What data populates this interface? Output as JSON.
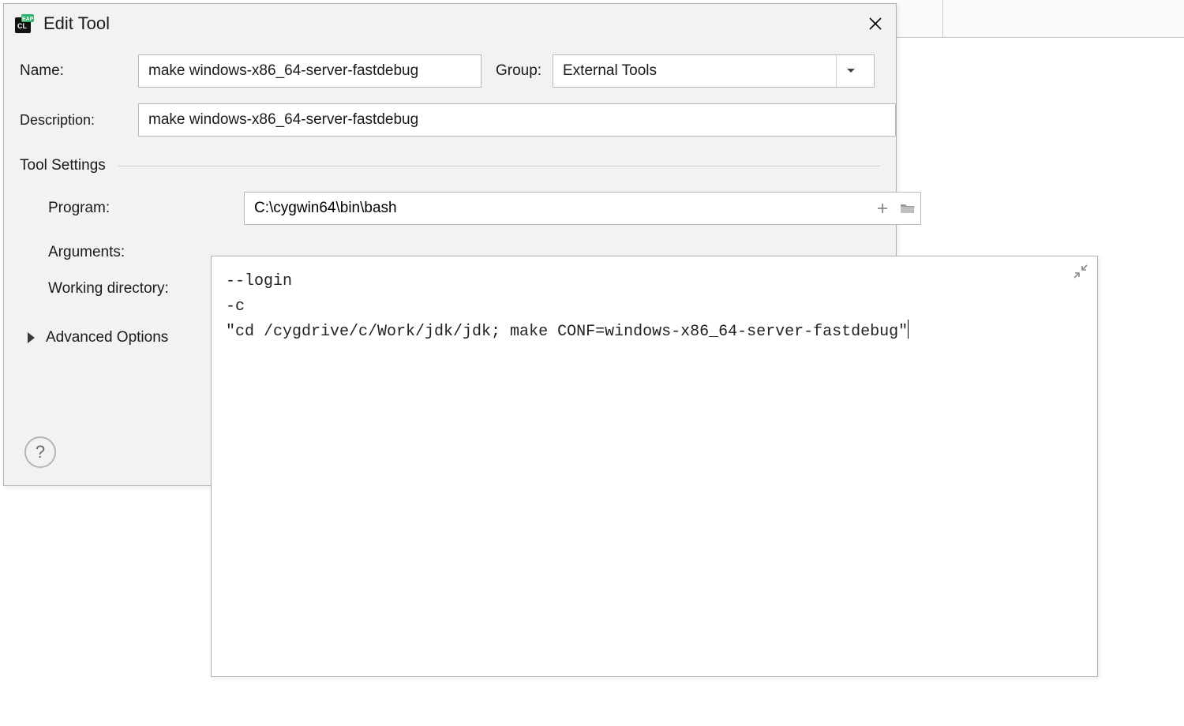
{
  "dialog": {
    "title": "Edit Tool",
    "labels": {
      "name": "Name:",
      "group": "Group:",
      "description": "Description:"
    },
    "name_value": "make windows-x86_64-server-fastdebug",
    "group_value": "External Tools",
    "description_value": "make windows-x86_64-server-fastdebug",
    "tool_settings_header": "Tool Settings",
    "tool_settings": {
      "program_label": "Program:",
      "program_value": "C:\\cygwin64\\bin\\bash",
      "arguments_label": "Arguments:",
      "working_dir_label": "Working directory:"
    },
    "advanced_options_label": "Advanced Options",
    "help_label": "?"
  },
  "arguments_popup": {
    "text": "--login\n-c\n\"cd /cygdrive/c/Work/jdk/jdk; make CONF=windows-x86_64-server-fastdebug\""
  }
}
